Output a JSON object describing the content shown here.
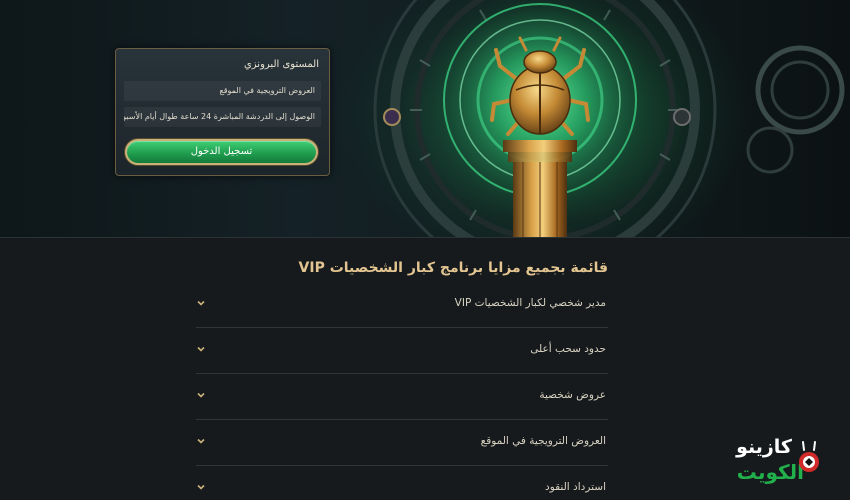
{
  "hero": {
    "card": {
      "title": "المستوى البرونزي",
      "rows": [
        "العروض الترويجية في الموقع",
        "الوصول إلى الدردشة المباشرة 24 ساعة طوال أيام الأسبوع"
      ],
      "login_label": "تسجيل الدخول"
    }
  },
  "benefits": {
    "title": "قائمة بجميع مزايا برنامج كبار الشخصيات VIP",
    "items": [
      "مدير شخصي لكبار الشخصيات VIP",
      "حدود سحب أعلى",
      "عروض شخصية",
      "العروض الترويجية في الموقع",
      "استرداد النقود"
    ]
  },
  "logo": {
    "line1": "كازينو",
    "line2": "الكويت"
  },
  "colors": {
    "accent_gold": "#e3c591",
    "button_green": "#2fb862",
    "logo_green": "#21b04b",
    "background": "#161a1c"
  }
}
